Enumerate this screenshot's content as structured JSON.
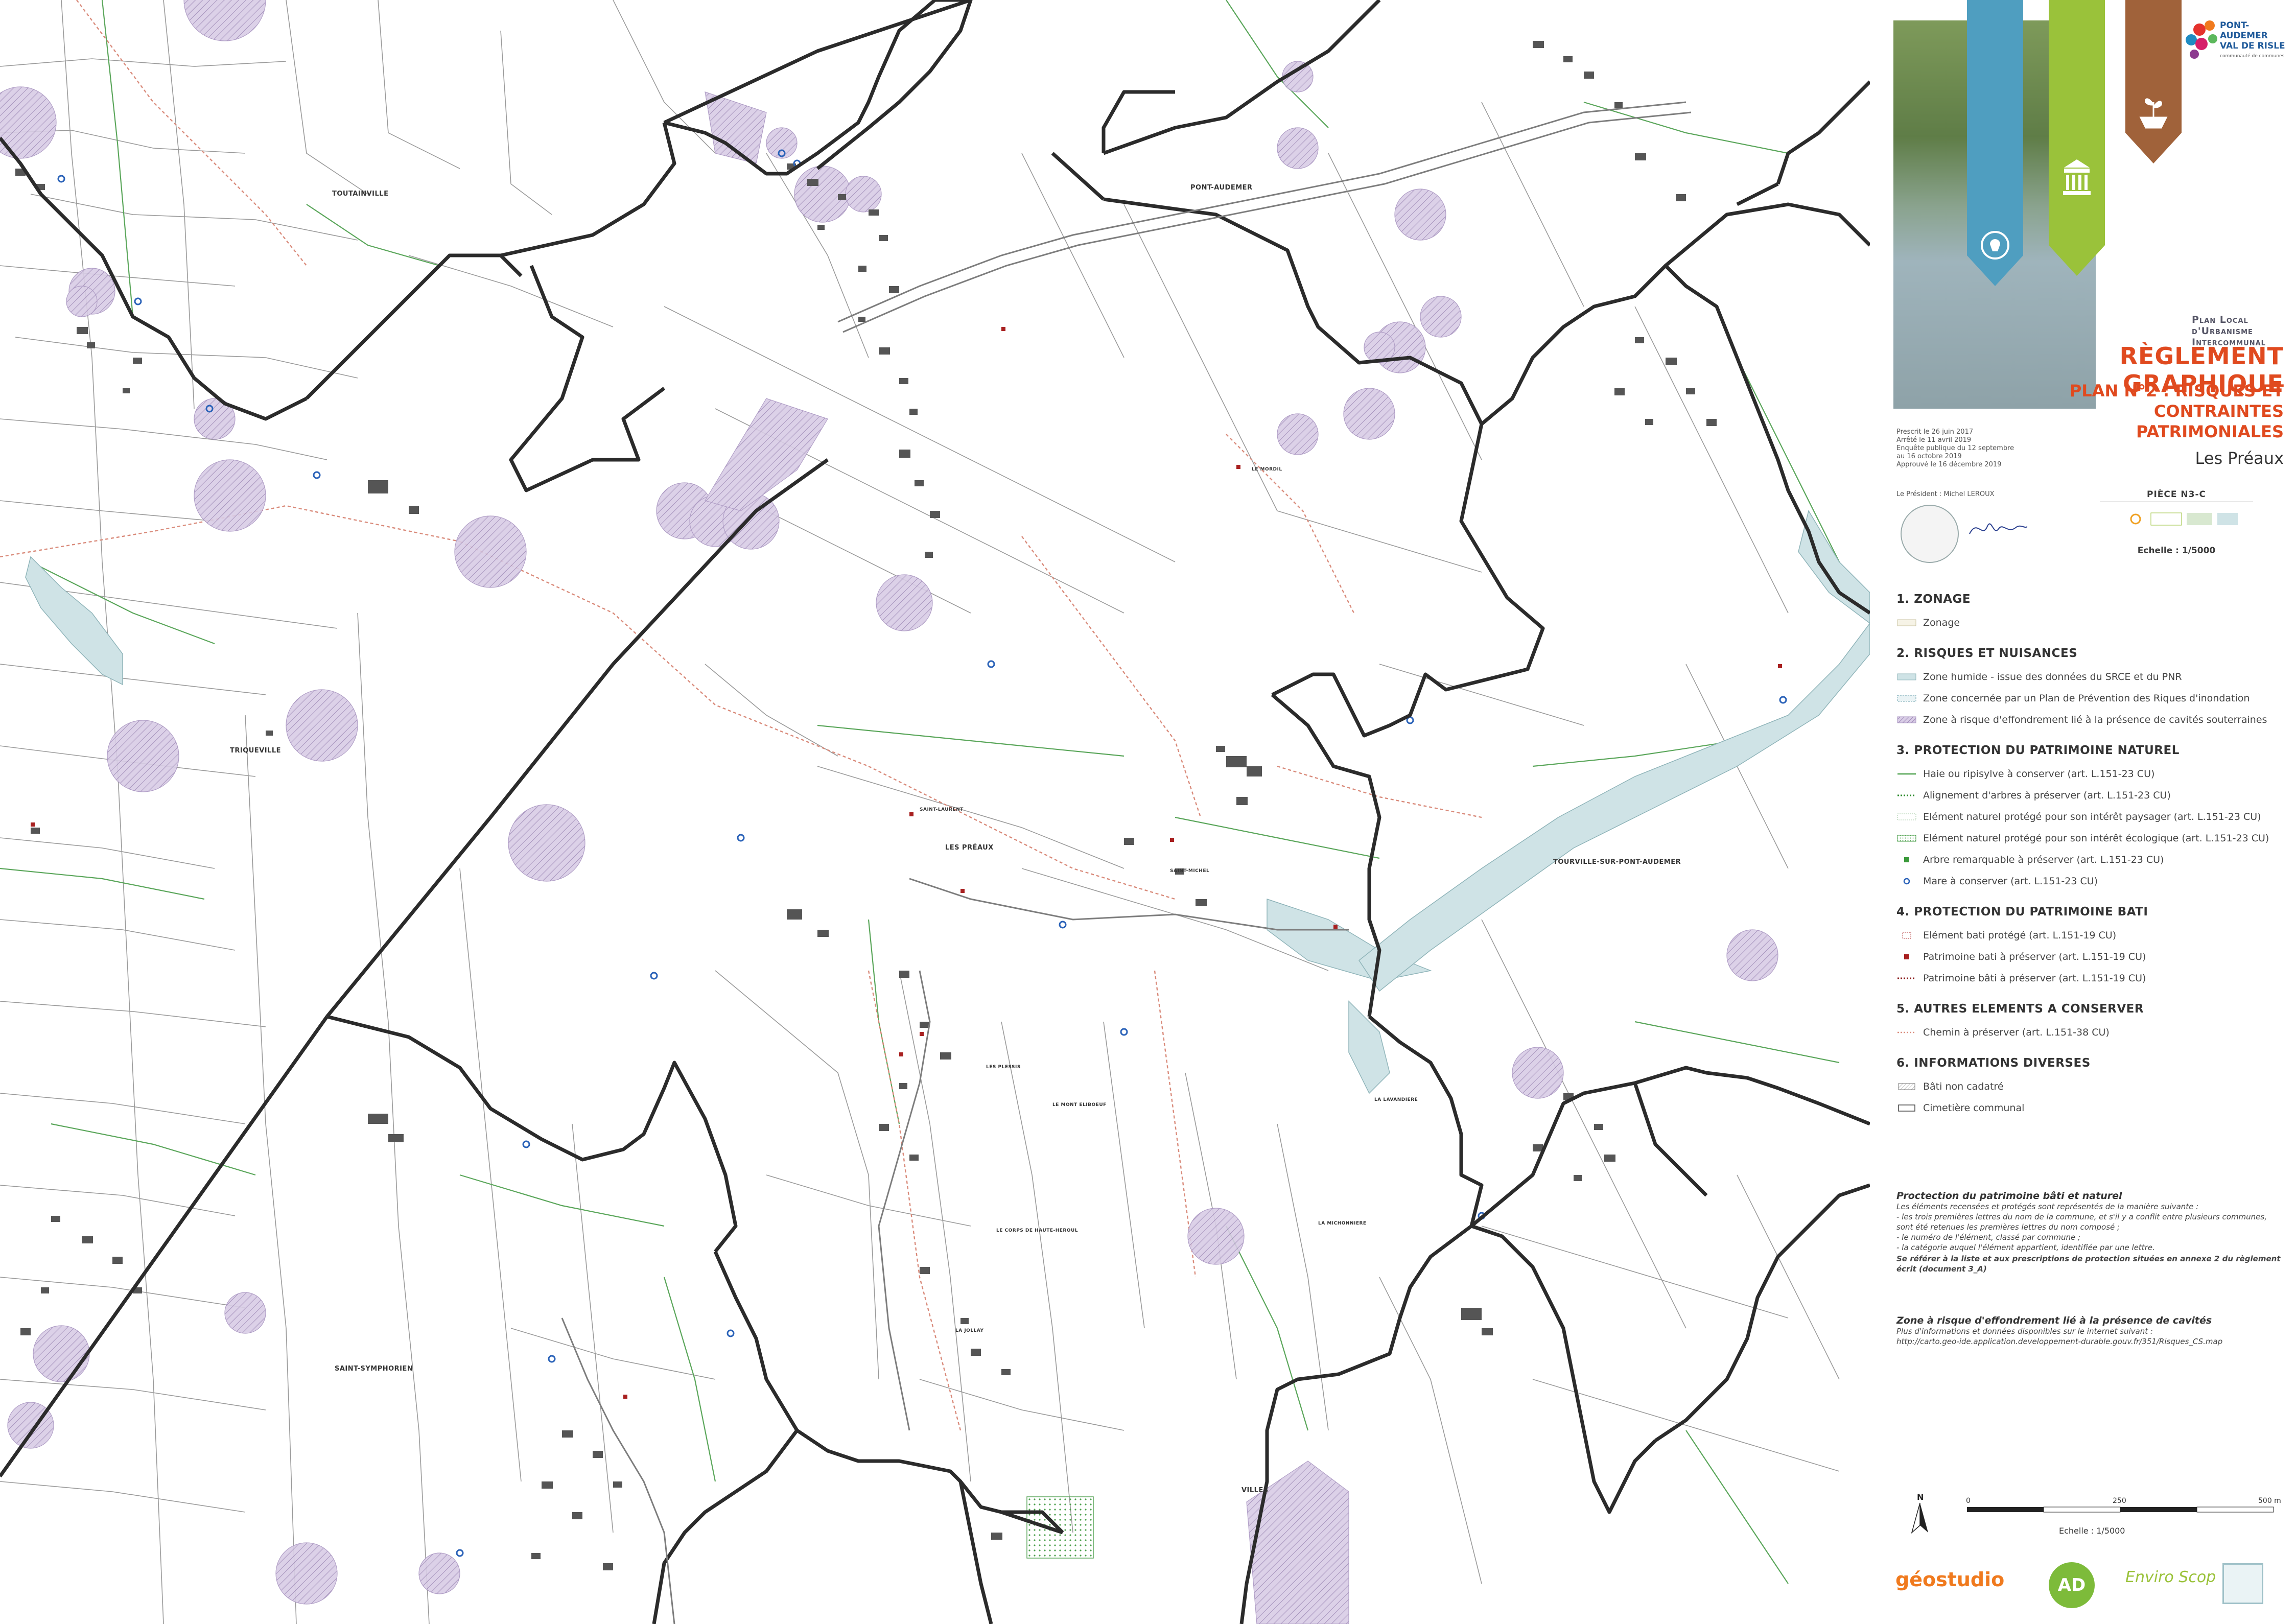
{
  "map": {
    "place_labels": [
      "TOUTAINVILLE",
      "PONT-AUDEMER",
      "TRIQUEVILLE",
      "LES PRÉAUX",
      "TOURVILLE-SUR-PONT-AUDEMER",
      "SAINT-SYMPHORIEN",
      "LE MORDIL",
      "SAINT-LAURENT",
      "SAINT-MICHEL",
      "LES PLESSIS",
      "LE MONT ELIBOEUF",
      "LE CORPS DE HAUTE-HEROUL",
      "LA MICHONNIERE",
      "LA LAVANDIERE",
      "LA JOLLAY",
      "VILLES"
    ],
    "colors": {
      "commune_boundary": "#2b2b2b",
      "hedge_line": "#4fa14f",
      "path_line": "#d98a7a",
      "wetland": "#cfe3e6",
      "cavity_zone": "#b6a3c9",
      "parcel_line": "#8a8a8a",
      "building": "#555555",
      "pond": "#2a62b8",
      "heritage": "#a82020"
    }
  },
  "cartouche": {
    "program": "Plan Local d'Urbanisme Intercommunal",
    "title": "Règlement graphique",
    "subtitle_line1": "PLAN N°2 : RISQUES ET",
    "subtitle_line2": "CONTRAINTES PATRIMONIALES",
    "commune": "Les Préaux",
    "piece": "PIÈCE N3-C",
    "echelle": "Echelle : 1/5000",
    "dates": [
      "Prescrit le 26 juin 2017",
      "Arrêté le 11 avril 2019",
      "Enquête publique du 12 septembre",
      "au 16 octobre 2019",
      "Approuvé le 16 décembre 2019"
    ],
    "president": "Le Président : Michel LEROUX",
    "logo_line1": "PONT-AUDEMER",
    "logo_line2": "VAL DE RISLE",
    "logo_line3": "communauté de communes"
  },
  "legend": {
    "sections": [
      {
        "title": "1. ZONAGE",
        "items": [
          {
            "label": "Zonage",
            "symbol": "zonage"
          }
        ]
      },
      {
        "title": "2. RISQUES ET NUISANCES",
        "items": [
          {
            "label": "Zone humide - issue des données du SRCE et du PNR",
            "symbol": "wetland"
          },
          {
            "label": "Zone concernée par un Plan de Prévention des Riques d'inondation",
            "symbol": "ppri"
          },
          {
            "label": "Zone à risque d'effondrement lié à la présence de cavités souterraines",
            "symbol": "cavity"
          }
        ]
      },
      {
        "title": "3. PROTECTION DU PATRIMOINE NATUREL",
        "items": [
          {
            "label": "Haie ou ripisylve à conserver (art. L.151-23 CU)",
            "symbol": "hedge"
          },
          {
            "label": "Alignement d'arbres à préserver (art. L.151-23 CU)",
            "symbol": "tree-line"
          },
          {
            "label": "Elément naturel protégé pour son intérêt paysager (art. L.151-23 CU)",
            "symbol": "natural-landscape"
          },
          {
            "label": "Elément naturel protégé pour son intérêt écologique (art. L.151-23 CU)",
            "symbol": "natural-ecology"
          },
          {
            "label": "Arbre remarquable à préserver (art. L.151-23 CU)",
            "symbol": "tree"
          },
          {
            "label": "Mare à conserver (art. L.151-23 CU)",
            "symbol": "pond"
          }
        ]
      },
      {
        "title": "4. PROTECTION DU PATRIMOINE BATI",
        "items": [
          {
            "label": "Elément bati protégé (art. L.151-19 CU)",
            "symbol": "built-protected"
          },
          {
            "label": "Patrimoine bati à préserver (art. L.151-19 CU)",
            "symbol": "heritage-point"
          },
          {
            "label": "Patrimoine bâti à préserver (art. L.151-19 CU)",
            "symbol": "heritage-line"
          }
        ]
      },
      {
        "title": "5. AUTRES ELEMENTS A CONSERVER",
        "items": [
          {
            "label": "Chemin à préserver  (art. L.151-38 CU)",
            "symbol": "path"
          }
        ]
      },
      {
        "title": "6. INFORMATIONS DIVERSES",
        "items": [
          {
            "label": "Bâti non cadatré",
            "symbol": "uncadastred"
          },
          {
            "label": "Cimetière communal",
            "symbol": "cemetery"
          }
        ]
      }
    ],
    "note1_title": "Proctection du patrimoine bâti et naturel",
    "note1_lines": [
      "Les éléments recensées et protégés sont représentés de la manière suivante :",
      "- les trois premières lettres du nom de la commune, et s'il y a conflit entre plusieurs communes,",
      "  sont été retenues les premières lettres du nom composé ;",
      "- le numéro de l'élément, classé par commune ;",
      "- la catégorie auquel l'élément appartient, identifiée par une lettre."
    ],
    "note1_bold": "Se référer à la liste et aux prescriptions de protection situées en annexe 2 du règlement écrit (document 3_A)",
    "note2_title": "Zone à risque d'effondrement lié à la présence de cavités",
    "note2_lines": [
      "Plus d'informations et données disponibles sur le internet suivant :",
      "http://carto.geo-ide.application.developpement-durable.gouv.fr/351/Risques_CS.map"
    ]
  },
  "scale": {
    "ticks": [
      "0",
      "250",
      "500 m"
    ],
    "label": "Echelle : 1/5000",
    "north": "N"
  },
  "footer_logos": [
    "géostudio",
    "AD",
    "Enviro Scop"
  ]
}
